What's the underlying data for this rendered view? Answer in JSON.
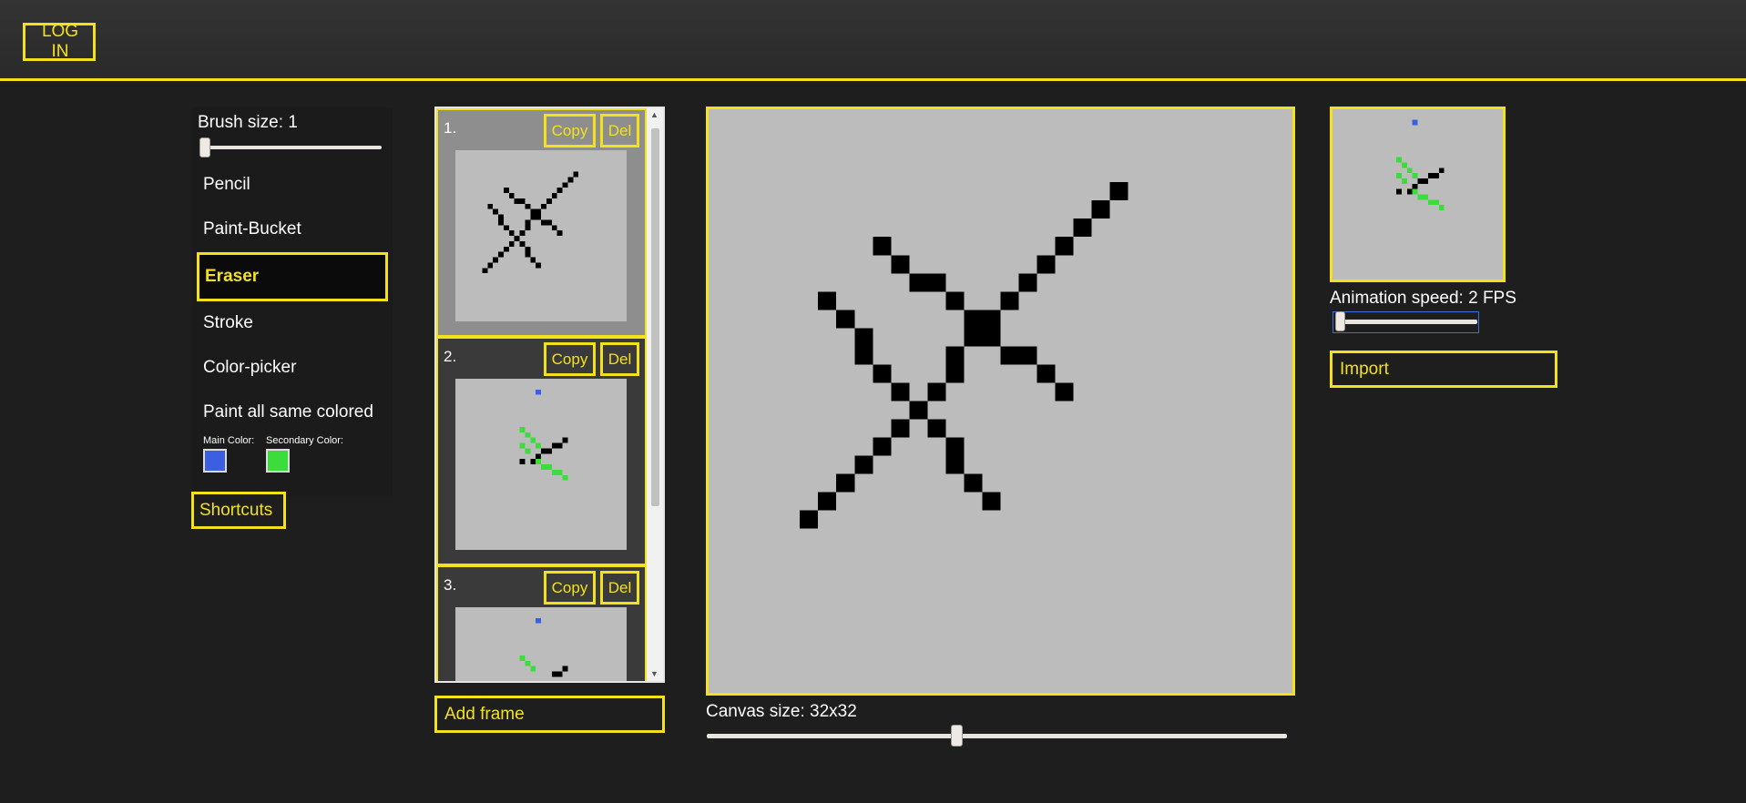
{
  "header": {
    "login_label": "LOG IN"
  },
  "tools": {
    "brush_size_label": "Brush size: 1",
    "brush_size_value": 1,
    "items": [
      {
        "label": "Pencil",
        "active": false
      },
      {
        "label": "Paint-Bucket",
        "active": false
      },
      {
        "label": "Eraser",
        "active": true
      },
      {
        "label": "Stroke",
        "active": false
      },
      {
        "label": "Color-picker",
        "active": false
      },
      {
        "label": "Paint all same colored",
        "active": false
      }
    ],
    "main_color_label": "Main Color:",
    "secondary_color_label": "Secondary Color:",
    "main_color": "#3b5fe0",
    "secondary_color": "#3ddc3d",
    "shortcuts_label": "Shortcuts"
  },
  "frames": {
    "items": [
      {
        "number": "1.",
        "copy_label": "Copy",
        "delete_label": "Del",
        "selected": true
      },
      {
        "number": "2.",
        "copy_label": "Copy",
        "delete_label": "Del",
        "selected": false
      },
      {
        "number": "3.",
        "copy_label": "Copy",
        "delete_label": "Del",
        "selected": false
      }
    ],
    "add_frame_label": "Add frame"
  },
  "canvas": {
    "size_label": "Canvas size: 32x32",
    "background": "#bcbcbc"
  },
  "preview": {
    "animation_speed_label": "Animation speed: 2 FPS",
    "fps": 2,
    "import_label": "Import"
  },
  "colors": {
    "accent": "#f3e11c",
    "background": "#1e1e1e",
    "pixel": "#000000"
  }
}
